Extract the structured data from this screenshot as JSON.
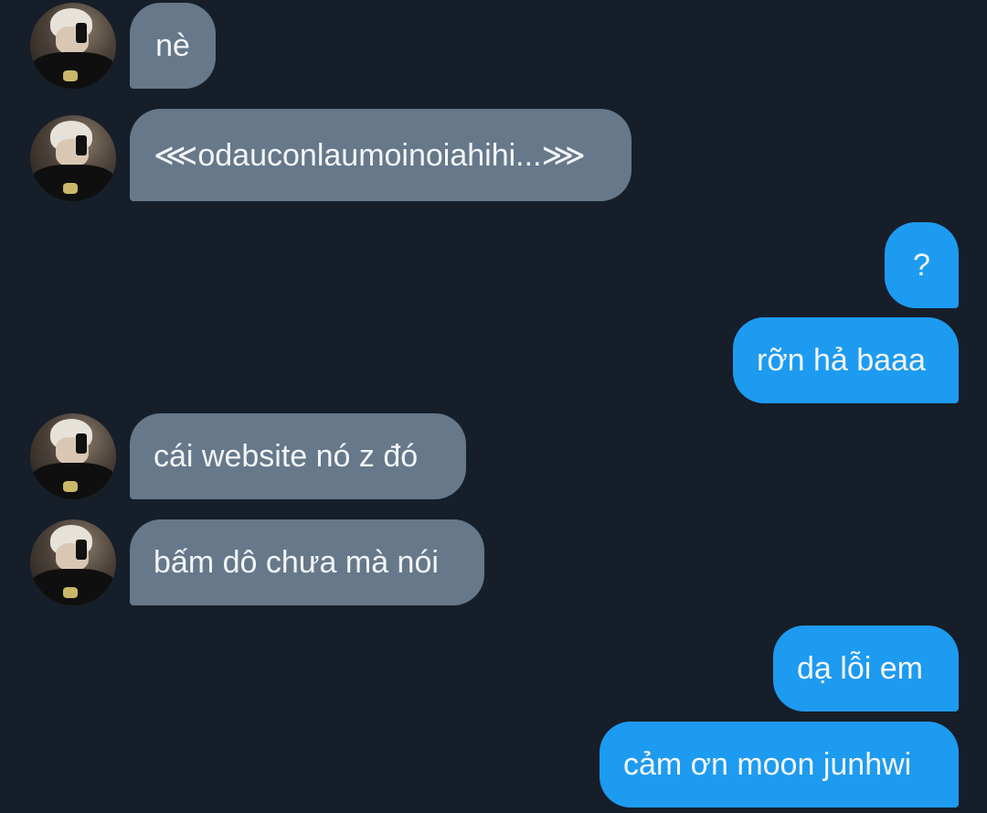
{
  "colors": {
    "background": "#161e29",
    "incoming_bubble": "#66788a",
    "outgoing_bubble": "#1d9bf0",
    "text": "#f3f5f7"
  },
  "messages": [
    {
      "sender": "them",
      "text": "nè"
    },
    {
      "sender": "them",
      "text": "⋘odauconlaumoinoiahihi...⋙"
    },
    {
      "sender": "me",
      "text": "?"
    },
    {
      "sender": "me",
      "text": "rỡn hả baaa"
    },
    {
      "sender": "them",
      "text": "cái website nó z đó"
    },
    {
      "sender": "them",
      "text": "bấm dô chưa mà nói"
    },
    {
      "sender": "me",
      "text": "dạ lỗi em"
    },
    {
      "sender": "me",
      "text": "cảm ơn moon junhwi"
    }
  ]
}
